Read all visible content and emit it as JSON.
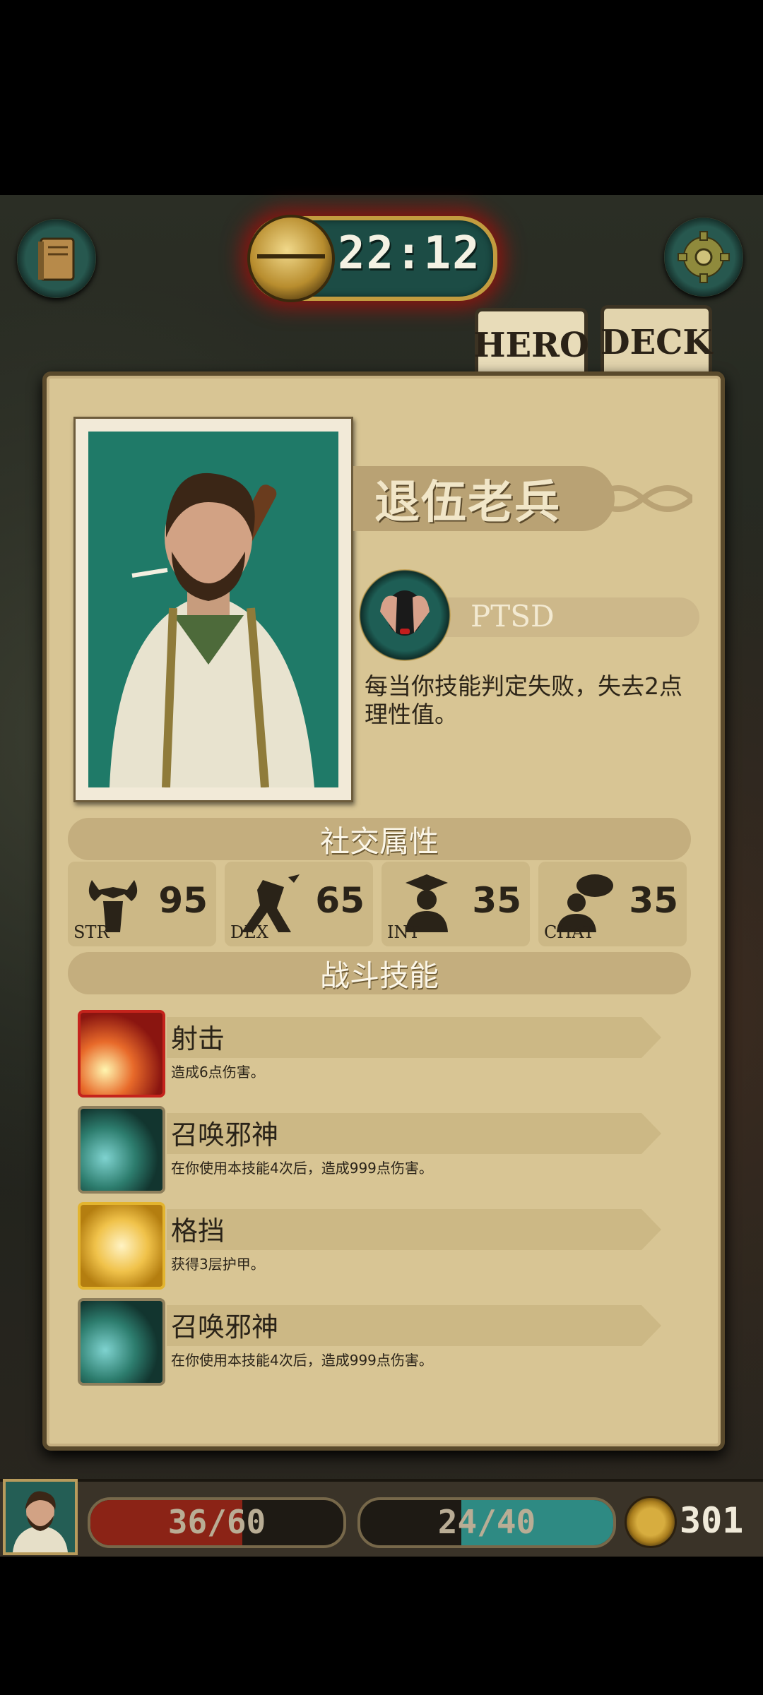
{
  "hud": {
    "timer": "22:12"
  },
  "tabs": [
    {
      "label": "HERO",
      "active": true
    },
    {
      "label": "DECK",
      "active": false
    }
  ],
  "hero": {
    "name": "退伍老兵",
    "trait": {
      "name": "PTSD",
      "description": "每当你技能判定失败，失去2点理性值。"
    }
  },
  "sections": {
    "social": "社交属性",
    "combat": "战斗技能"
  },
  "stats": [
    {
      "label": "STR",
      "value": "95",
      "icon": "strength-icon"
    },
    {
      "label": "DEX",
      "value": "65",
      "icon": "dexterity-icon"
    },
    {
      "label": "INT",
      "value": "35",
      "icon": "intelligence-icon"
    },
    {
      "label": "CHAT",
      "value": "35",
      "icon": "chat-icon"
    }
  ],
  "skills": [
    {
      "name": "射击",
      "description": "造成6点伤害。",
      "icon": "shoot-icon",
      "frame_color": "#c4231c"
    },
    {
      "name": "召唤邪神",
      "description": "在你使用本技能4次后，造成999点伤害。",
      "icon": "summon-icon",
      "frame_color": "#8e7f5c"
    },
    {
      "name": "格挡",
      "description": "获得3层护甲。",
      "icon": "block-icon",
      "frame_color": "#e3b42e"
    },
    {
      "name": "召唤邪神",
      "description": "在你使用本技能4次后，造成999点伤害。",
      "icon": "summon-icon",
      "frame_color": "#8e7f5c"
    }
  ],
  "status": {
    "hp": "36/60",
    "hp_fraction": 0.6,
    "sanity": "24/40",
    "sanity_fraction": 0.6,
    "gold": "301"
  },
  "colors": {
    "hp": "#8b2316",
    "sanity": "#2e8a83",
    "panel": "#d8c594"
  }
}
